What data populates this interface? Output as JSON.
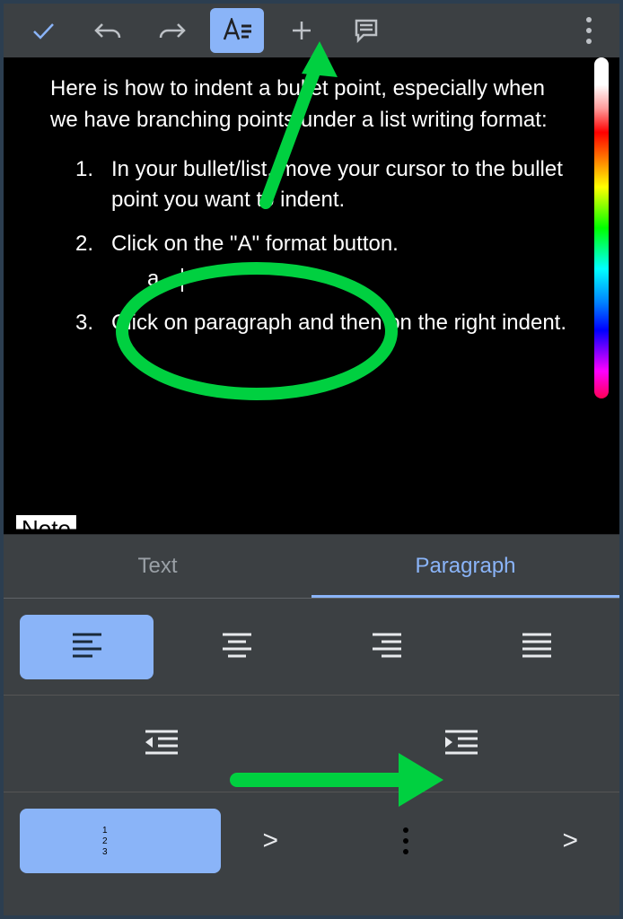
{
  "toolbar": {
    "check": "check-icon",
    "undo": "undo-icon",
    "redo": "redo-icon",
    "format": "text-format-icon",
    "add": "plus-icon",
    "comment": "comment-icon",
    "more": "more-vert-icon"
  },
  "document": {
    "intro": "Here is how to indent a bullet point, especially when we have branching points under a list writing format:",
    "items": [
      {
        "num": "1.",
        "text": "In your bullet/list, move your cursor to the bullet point you want to indent."
      },
      {
        "num": "2.",
        "text": "Click on the \"A\" format button.",
        "sub": [
          {
            "letter": "a.",
            "text": ""
          }
        ]
      },
      {
        "num": "3.",
        "text": "Click on paragraph and then on the right indent."
      }
    ]
  },
  "note_label": "Note",
  "panel": {
    "tabs": {
      "text": "Text",
      "paragraph": "Paragraph",
      "active": "paragraph"
    },
    "align": {
      "left": "align-left-icon",
      "center": "align-center-icon",
      "right": "align-right-icon",
      "justify": "align-justify-icon",
      "selected": "left"
    },
    "indent": {
      "decrease": "indent-decrease-icon",
      "increase": "indent-increase-icon"
    },
    "lists": {
      "ordered": "ordered-list-icon",
      "bulleted": "bulleted-list-icon",
      "selected": "ordered",
      "chevron": ">"
    }
  },
  "colors": {
    "accent": "#8ab4f8",
    "annotation": "#00d040"
  }
}
